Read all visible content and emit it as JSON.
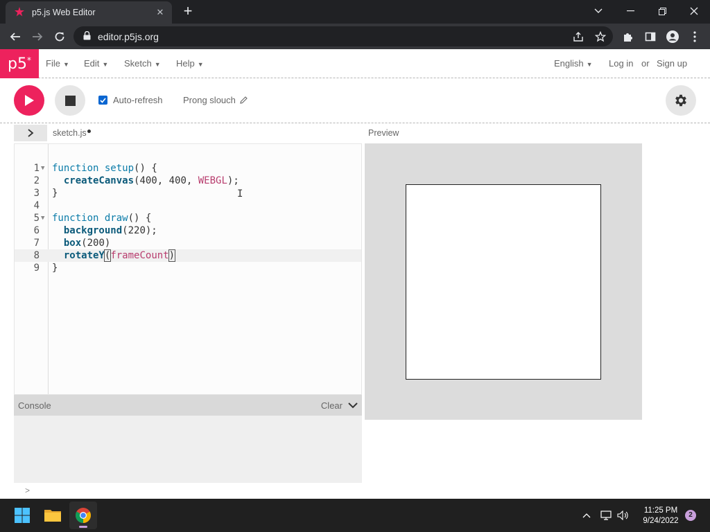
{
  "browser": {
    "tab_title": "p5.js Web Editor",
    "url": "editor.p5js.org"
  },
  "nav": {
    "logo": "p5",
    "logo_sup": "*",
    "menus": [
      "File",
      "Edit",
      "Sketch",
      "Help"
    ],
    "language": "English",
    "login": "Log in",
    "or": "or",
    "signup": "Sign up"
  },
  "toolbar": {
    "auto_refresh_label": "Auto-refresh",
    "auto_refresh_checked": true,
    "sketch_name": "Prong slouch"
  },
  "editor": {
    "file_name": "sketch.js",
    "lines": [
      {
        "n": "1",
        "text": "function setup() {"
      },
      {
        "n": "2",
        "text": "  createCanvas(400, 400, WEBGL);"
      },
      {
        "n": "3",
        "text": "}"
      },
      {
        "n": "4",
        "text": ""
      },
      {
        "n": "5",
        "text": "function draw() {"
      },
      {
        "n": "6",
        "text": "  background(220);"
      },
      {
        "n": "7",
        "text": "  box(200)"
      },
      {
        "n": "8",
        "text": "  rotateY(frameCount)"
      },
      {
        "n": "9",
        "text": "}"
      }
    ]
  },
  "console": {
    "title": "Console",
    "clear": "Clear",
    "prompt": ">"
  },
  "preview": {
    "label": "Preview"
  },
  "taskbar": {
    "time": "11:25 PM",
    "date": "9/24/2022",
    "notifications": "2"
  },
  "colors": {
    "p5_pink": "#ed225d",
    "keyword": "#0b7ca9",
    "constant": "#b83d6e"
  }
}
